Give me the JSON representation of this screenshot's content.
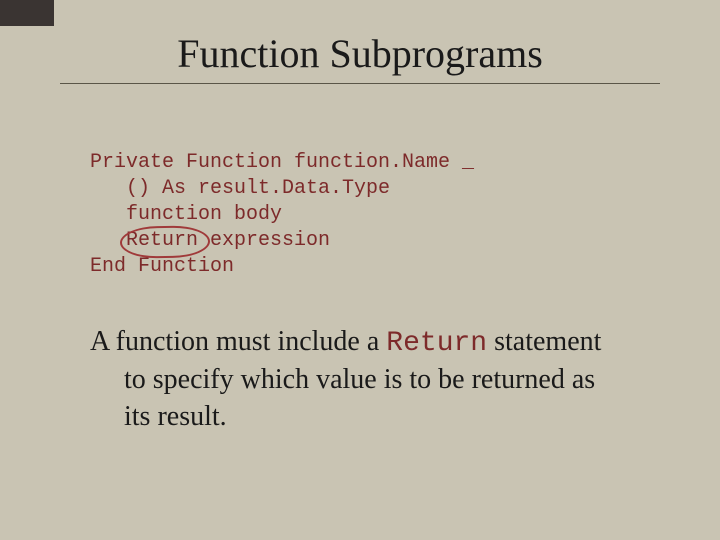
{
  "title": "Function Subprograms",
  "code": {
    "l1": "Private Function function.Name _",
    "l2": "   () As result.Data.Type",
    "l3": "   function body",
    "l4_pre": "   ",
    "l4_return": "Return",
    "l4_post": " expression",
    "l5": "End Function"
  },
  "paragraph": {
    "p1": "A function must include a ",
    "mono": "Return",
    "p2": " statement",
    "p3": "to specify which value is to be returned as",
    "p4": "its result."
  }
}
